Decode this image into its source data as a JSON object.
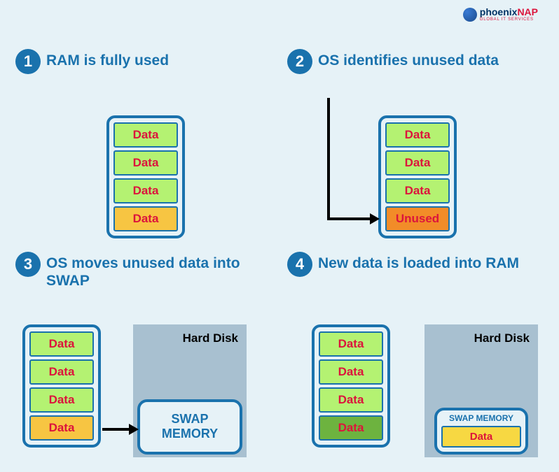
{
  "brand": {
    "name": "phoenix",
    "accent": "NAP",
    "tagline": "GLOBAL IT SERVICES"
  },
  "steps": [
    {
      "num": "1",
      "title": "RAM is fully used"
    },
    {
      "num": "2",
      "title": "OS identifies unused data"
    },
    {
      "num": "3",
      "title": "OS moves unused data into SWAP"
    },
    {
      "num": "4",
      "title": "New data is loaded into RAM"
    }
  ],
  "cells": {
    "data": "Data",
    "unused": "Unused"
  },
  "disk": {
    "label": "Hard Disk",
    "swap": "SWAP MEMORY",
    "swap_line1": "SWAP",
    "swap_line2": "MEMORY"
  }
}
